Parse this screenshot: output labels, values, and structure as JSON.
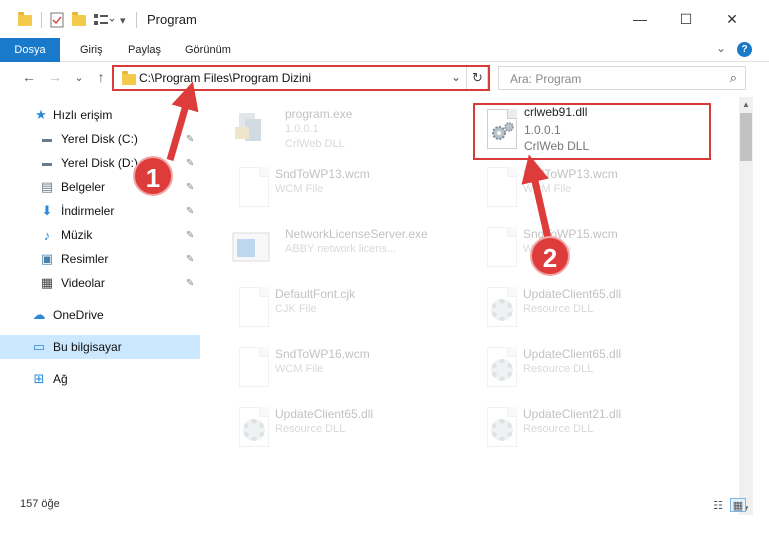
{
  "window": {
    "title": "Program",
    "controls": {
      "minimize": "—",
      "maximize": "☐",
      "close": "✕"
    }
  },
  "ribbon": {
    "tabs": [
      "Dosya",
      "Giriş",
      "Paylaş",
      "Görünüm"
    ],
    "help": "?"
  },
  "nav": {
    "back": "←",
    "forward": "→",
    "recent": "⌄",
    "up": "↑",
    "address": "C:\\Program Files\\Program Dizini",
    "refresh": "↻",
    "search_placeholder": "Ara: Program",
    "search_icon": "⌕"
  },
  "sidebar": {
    "items": [
      {
        "label": "Hızlı erişim",
        "icon": "star-icon",
        "glyph": "★"
      },
      {
        "label": "Yerel Disk (C:)",
        "icon": "drive-icon",
        "glyph": "▬",
        "pinned": true
      },
      {
        "label": "Yerel Disk (D:)",
        "icon": "drive-icon",
        "glyph": "▬",
        "pinned": true
      },
      {
        "label": "Belgeler",
        "icon": "documents-icon",
        "glyph": "▤",
        "pinned": true
      },
      {
        "label": "İndirmeler",
        "icon": "download-icon",
        "glyph": "⬇",
        "pinned": true
      },
      {
        "label": "Müzik",
        "icon": "music-icon",
        "glyph": "♪",
        "pinned": true
      },
      {
        "label": "Resimler",
        "icon": "pictures-icon",
        "glyph": "▣",
        "pinned": true
      },
      {
        "label": "Videolar",
        "icon": "video-icon",
        "glyph": "▦",
        "pinned": true
      },
      {
        "label": "OneDrive",
        "icon": "cloud-icon",
        "glyph": "☁"
      },
      {
        "label": "Bu bilgisayar",
        "icon": "computer-icon",
        "glyph": "▭",
        "selected": true
      },
      {
        "label": "Ağ",
        "icon": "network-icon",
        "glyph": "⊞"
      }
    ],
    "pin_glyph": "📌"
  },
  "files": [
    {
      "name": "program.exe",
      "sub1": "1.0.0.1",
      "sub2": "CrlWeb DLL",
      "kind": "exe",
      "faded": true
    },
    {
      "name": "crlweb91.dll",
      "sub1": "1.0.0.1",
      "sub2": "CrlWeb DLL",
      "kind": "dll",
      "faded": false
    },
    {
      "name": "SndToWP13.wcm",
      "sub1": "WCM File",
      "kind": "blank",
      "faded": true
    },
    {
      "name": "SndToWP13.wcm",
      "sub1": "WCM File",
      "kind": "blank",
      "faded": true
    },
    {
      "name": "NetworkLicenseServer.exe",
      "sub1": "ABBY network licens...",
      "kind": "app",
      "faded": true
    },
    {
      "name": "SndToWP15.wcm",
      "sub1": "WCM File",
      "kind": "blank",
      "faded": true
    },
    {
      "name": "DefaultFont.cjk",
      "sub1": "CJK File",
      "kind": "blank",
      "faded": true
    },
    {
      "name": "UpdateClient65.dll",
      "sub1": "Resource DLL",
      "kind": "dll",
      "faded": true
    },
    {
      "name": "SndToWP16.wcm",
      "sub1": "WCM File",
      "kind": "blank",
      "faded": true
    },
    {
      "name": "UpdateClient65.dll",
      "sub1": "Resource DLL",
      "kind": "dll",
      "faded": true
    },
    {
      "name": "UpdateClient65.dll",
      "sub1": "Resource DLL",
      "kind": "dll",
      "faded": true
    },
    {
      "name": "UpdateClient21.dll",
      "sub1": "Resource DLL",
      "kind": "dll",
      "faded": true
    }
  ],
  "status": {
    "count": "157 öğe",
    "details_view": "☷",
    "tiles_view": "▦"
  },
  "callouts": {
    "step1": "1",
    "step2": "2",
    "color": "#de3b3b"
  },
  "scroll": {
    "up": "▲",
    "down": "▼"
  }
}
